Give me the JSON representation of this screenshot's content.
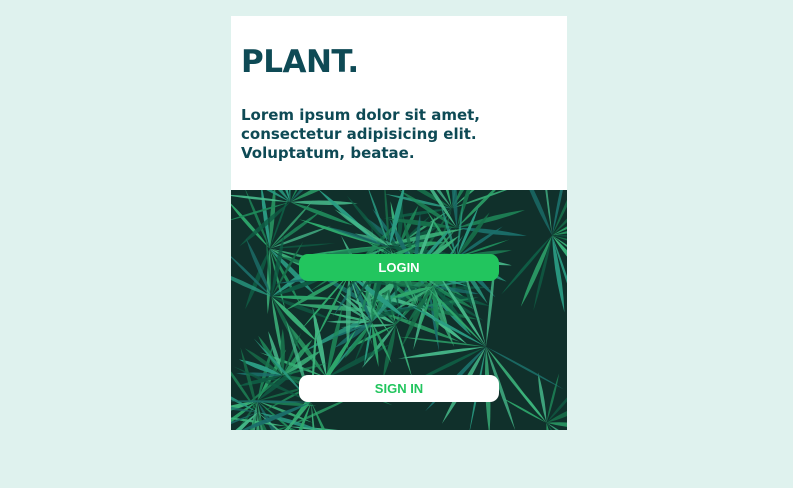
{
  "colors": {
    "page_background": "#dff2ee",
    "card_background": "#ffffff",
    "brand_text": "#0e4a55",
    "accent_green": "#22c55e",
    "leaf_dark": "#0f2a26"
  },
  "header": {
    "brand": "PLANT.",
    "tagline": "Lorem ipsum dolor sit amet, consectetur adipisicing elit. Voluptatum, beatae."
  },
  "hero": {
    "image": "tropical-leaves-image"
  },
  "actions": {
    "login_label": "LOGIN",
    "signin_label": "SIGN IN"
  }
}
